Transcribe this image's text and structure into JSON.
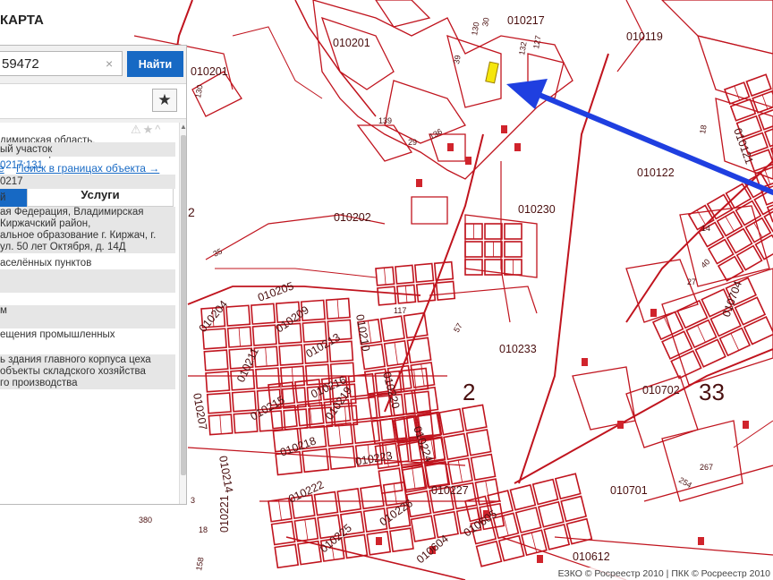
{
  "header": {
    "brand": "КАРТА"
  },
  "search": {
    "value": "59472",
    "clear_glyph": "×",
    "button_label": "Найти"
  },
  "toolbar": {
    "favorite_glyph": "★"
  },
  "card": {
    "icons": "⚠★^",
    "address_lines": [
      "димирская область,",
      "альное образование..."
    ],
    "link_left": "e",
    "link_right": "Поиск в границах объекта →",
    "tab_services": "Услуги",
    "rows": [
      {
        "text": "ый участок",
        "style": "gray"
      },
      {
        "text": "0217:131",
        "style": "link"
      },
      {
        "text": "0217",
        "style": "gray"
      },
      {
        "text": "й",
        "style": "plain"
      },
      {
        "text": "ая Федерация, Владимирская",
        "style": "gray"
      },
      {
        "text": "Киржачский район,",
        "style": "gray"
      },
      {
        "text": "альное образование г. Киржач, г.",
        "style": "gray"
      },
      {
        "text": "ул. 50 лет Октября, д. 14Д",
        "style": "gray"
      },
      {
        "text": "аселённых пунктов",
        "style": "plain"
      },
      {
        "text": "",
        "style": "gray"
      },
      {
        "text": "",
        "style": "gray"
      },
      {
        "text": "",
        "style": "plain"
      },
      {
        "text": "м",
        "style": "gray"
      },
      {
        "text": "",
        "style": "gray"
      },
      {
        "text": "ещения промышленных",
        "style": "plain"
      },
      {
        "text": "",
        "style": "plain"
      },
      {
        "text": "ь здания главного корпуса цеха",
        "style": "gray"
      },
      {
        "text": "объекты складского хозяйства",
        "style": "gray"
      },
      {
        "text": "го производства",
        "style": "gray"
      }
    ]
  },
  "map": {
    "area_labels": [
      "010201",
      "010217",
      "010119",
      "010201",
      "010202",
      "010230",
      "010122",
      "010205",
      "010209",
      "010210",
      "010204",
      "010233",
      "010211",
      "010213",
      "010216",
      "010220",
      "010702",
      "010215",
      "010219",
      "010207",
      "010218",
      "010224",
      "010214",
      "010222",
      "010227",
      "010701",
      "010223",
      "010226",
      "010605",
      "010225",
      "010604",
      "010612",
      "010221",
      "010704",
      "010121"
    ],
    "big_labels": [
      "2",
      "33",
      "2"
    ],
    "parcel_labels": [
      "30",
      "130",
      "132",
      "127",
      "39",
      "139",
      "29",
      "136",
      "130",
      "14",
      "40",
      "18",
      "27",
      "254",
      "267",
      "117",
      "57",
      "3",
      "380",
      "18",
      "158",
      "35"
    ],
    "copyright": "ЕЗКО © Росреестр 2010 | ПКК © Росреестр 2010"
  },
  "colors": {
    "parcel_line": "#c0141e",
    "highlight": "#f5e60c",
    "arrow": "#1f3fe0",
    "accent": "#1769c4"
  }
}
